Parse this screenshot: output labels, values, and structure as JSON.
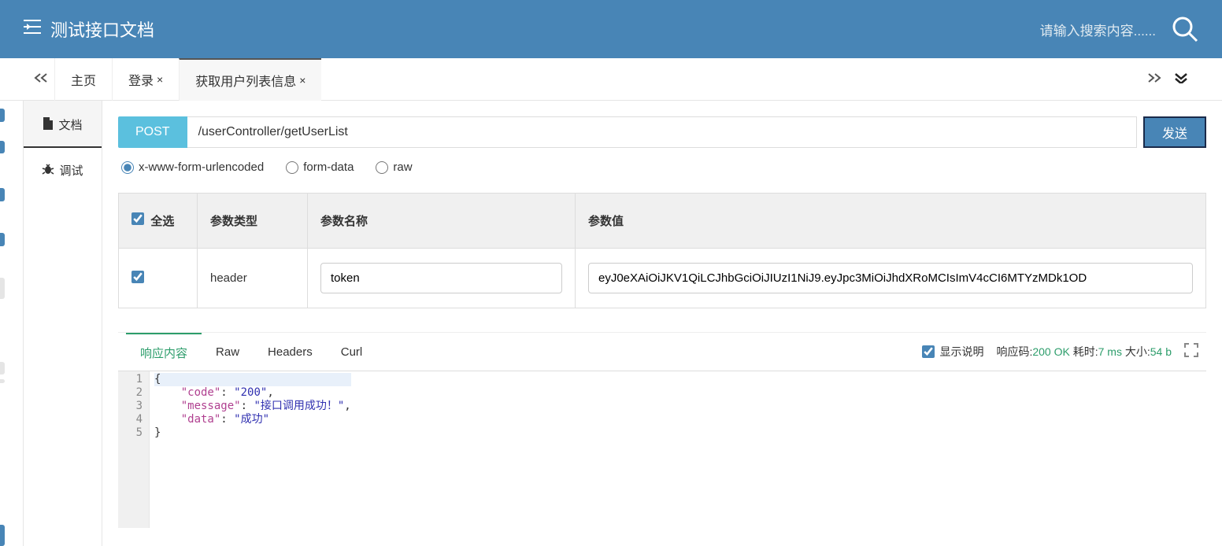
{
  "header": {
    "title": "测试接口文档",
    "search_placeholder": "请输入搜索内容......"
  },
  "tabs": {
    "home": "主页",
    "login": "登录",
    "userlist": "获取用户列表信息"
  },
  "subnav": {
    "doc": "文档",
    "debug": "调试"
  },
  "request": {
    "method": "POST",
    "url": "/userController/getUserList",
    "send": "发送"
  },
  "body_types": {
    "urlencoded": "x-www-form-urlencoded",
    "formdata": "form-data",
    "raw": "raw"
  },
  "param_headers": {
    "select_all": "全选",
    "type": "参数类型",
    "name": "参数名称",
    "value": "参数值"
  },
  "params": [
    {
      "type": "header",
      "name": "token",
      "value": "eyJ0eXAiOiJKV1QiLCJhbGciOiJIUzI1NiJ9.eyJpc3MiOiJhdXRoMCIsImV4cCI6MTYzMDk1OD"
    }
  ],
  "response_tabs": {
    "content": "响应内容",
    "raw": "Raw",
    "headers": "Headers",
    "curl": "Curl"
  },
  "response_meta": {
    "show_desc": "显示说明",
    "status_label": "响应码:",
    "status_value": "200 OK",
    "time_label": "耗时:",
    "time_value": "7 ms",
    "size_label": "大小:",
    "size_value": "54 b"
  },
  "response_body": {
    "code_key": "\"code\"",
    "code_val": "\"200\"",
    "message_key": "\"message\"",
    "message_val": "\"接口调用成功！\"",
    "data_key": "\"data\"",
    "data_val": "\"成功\""
  }
}
